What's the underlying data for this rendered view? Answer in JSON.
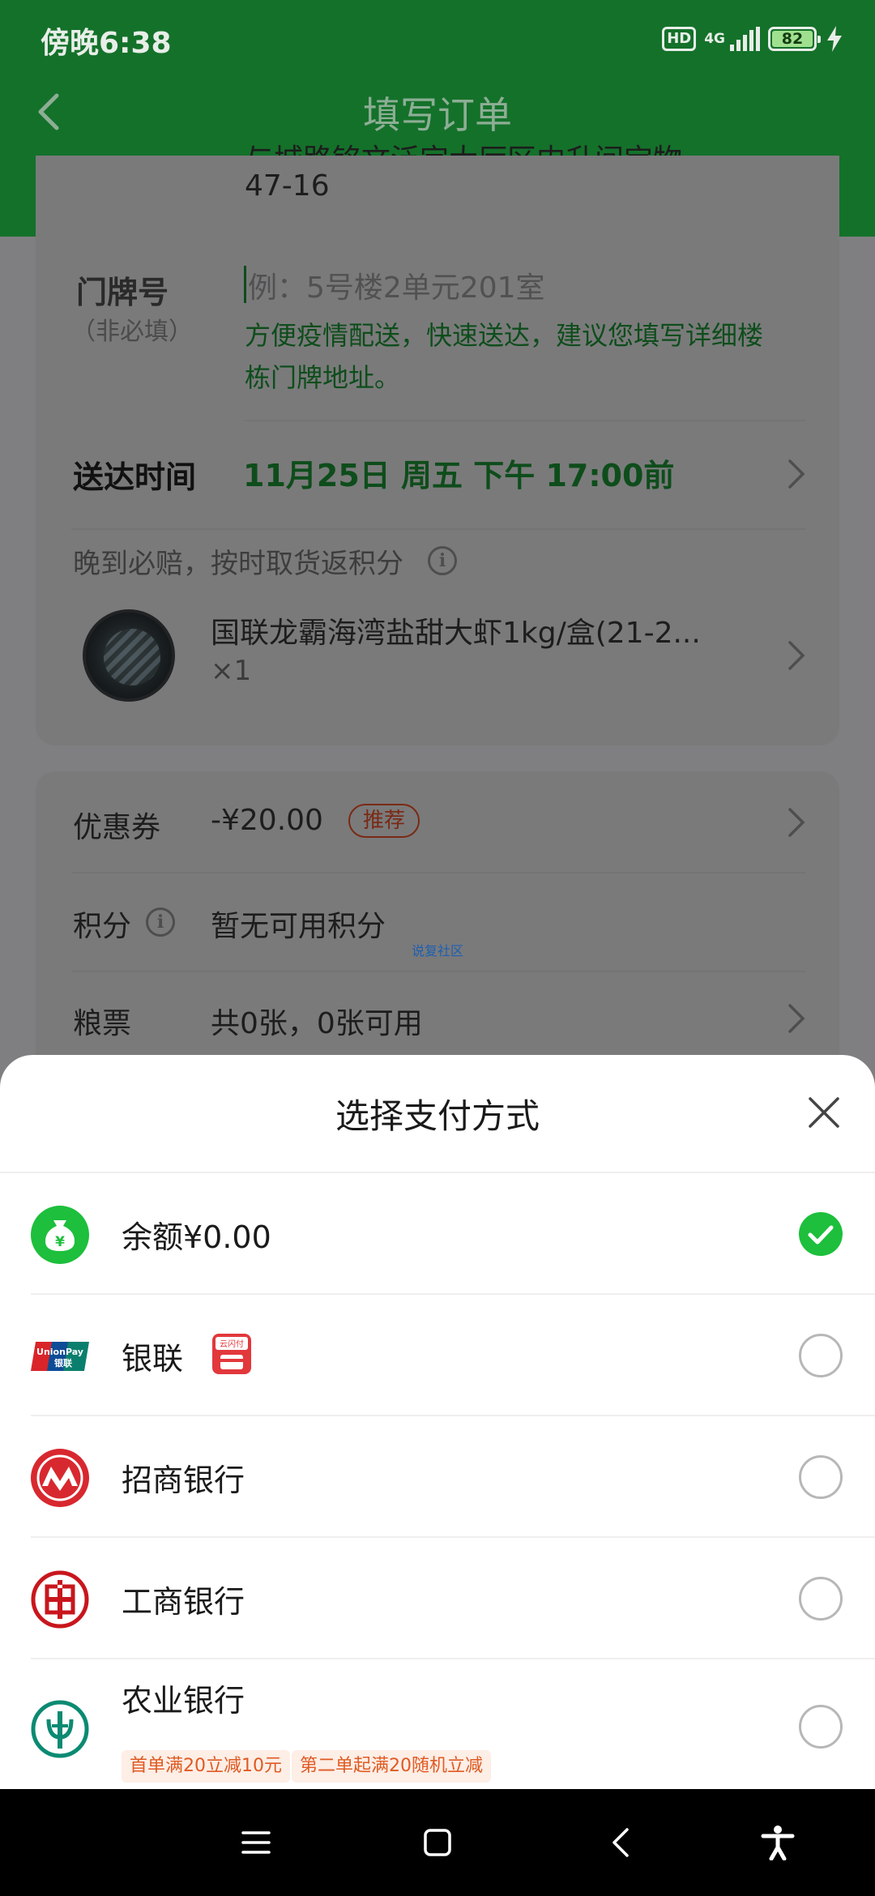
{
  "status_bar": {
    "time": "傍晚6:38",
    "hd": "HD",
    "network": "4G",
    "battery": "82"
  },
  "nav": {
    "title": "填写订单"
  },
  "address": {
    "line_cut": "与城路铭文泛定大厅区内升间宝物",
    "line_tail": "47-16"
  },
  "door_number": {
    "label": "门牌号",
    "sub_label": "（非必填）",
    "placeholder": "例：5号楼2单元201室",
    "tip": "方便疫情配送，快速送达，建议您填写详细楼栋门牌地址。"
  },
  "delivery": {
    "label": "送达时间",
    "time": "11月25日 周五 下午 17:00前"
  },
  "late_notice": "晚到必赔，按时取货返积分",
  "product": {
    "name": "国联龙霸海湾盐甜大虾1kg/盒(21-2...",
    "qty": "×1"
  },
  "coupon": {
    "label": "优惠券",
    "value": "-¥20.00",
    "badge": "推荐"
  },
  "points": {
    "label": "积分",
    "value": "暂无可用积分"
  },
  "grain": {
    "label": "粮票",
    "value": "共0张，0张可用"
  },
  "watermark": "说复社区",
  "sheet": {
    "title": "选择支付方式",
    "methods": [
      {
        "name": "余额¥0.00",
        "selected": true,
        "icon": "wallet-yen-icon"
      },
      {
        "name": "银联",
        "selected": false,
        "icon": "unionpay-icon",
        "logo_text": "UnionPay",
        "logo_sub": "银联",
        "extra_icon": "cloud-quickpass-icon",
        "extra_text": "云闪付"
      },
      {
        "name": "招商银行",
        "selected": false,
        "icon": "cmb-icon"
      },
      {
        "name": "工商银行",
        "selected": false,
        "icon": "icbc-icon"
      },
      {
        "name": "农业银行",
        "selected": false,
        "icon": "abc-icon",
        "promos": [
          "首单满20立减10元",
          "第二单起满20随机立减"
        ]
      }
    ]
  },
  "colors": {
    "accent": "#1dbf3c",
    "header_green": "#14712a",
    "promo": "#e05a22"
  }
}
